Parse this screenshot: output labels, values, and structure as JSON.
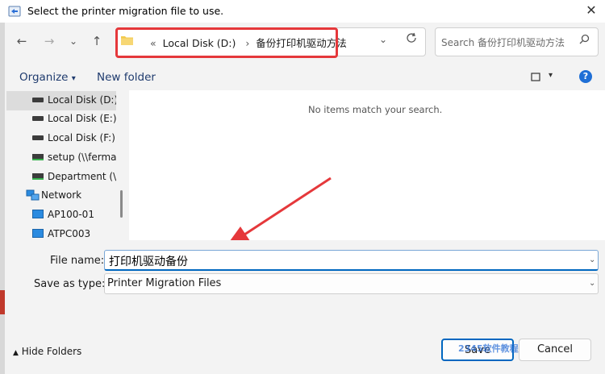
{
  "window": {
    "title": "Select the printer migration file to use.",
    "close_glyph": "✕"
  },
  "nav": {
    "back": "←",
    "forward": "→",
    "recent": "⌄",
    "up": "↑"
  },
  "address": {
    "overflow": "«",
    "segment1": "Local Disk (D:)",
    "separator": "›",
    "segment2": "备份打印机驱动方法"
  },
  "search": {
    "placeholder": "Search 备份打印机驱动方法"
  },
  "toolbar": {
    "organize": "Organize",
    "organize_caret": "▾",
    "new_folder": "New folder",
    "help": "?"
  },
  "navpane": {
    "items": [
      {
        "label": "Local Disk (D:)",
        "icon": "drive-icon"
      },
      {
        "label": "Local Disk (E:)",
        "icon": "drive-icon"
      },
      {
        "label": "Local Disk (F:)",
        "icon": "drive-icon"
      },
      {
        "label": "setup (\\\\fermato",
        "icon": "network-drive-icon"
      },
      {
        "label": "Department (\\\\f",
        "icon": "network-drive-icon"
      },
      {
        "label": "Network",
        "icon": "network-icon"
      },
      {
        "label": "AP100-01",
        "icon": "monitor-icon"
      },
      {
        "label": "ATPC003",
        "icon": "monitor-icon"
      }
    ]
  },
  "content": {
    "empty_message": "No items match your search."
  },
  "form": {
    "file_name_label": "File name:",
    "file_name_value": "打印机驱动备份",
    "save_as_type_label": "Save as type:",
    "save_as_type_value": "Printer Migration Files"
  },
  "footer": {
    "hide_folders": "Hide Folders",
    "hide_caret": "▲",
    "save": "Save",
    "cancel": "Cancel"
  },
  "watermark": {
    "text": "2345软件教程"
  },
  "colors": {
    "accent": "#0067c0",
    "highlight": "#e5383b"
  }
}
